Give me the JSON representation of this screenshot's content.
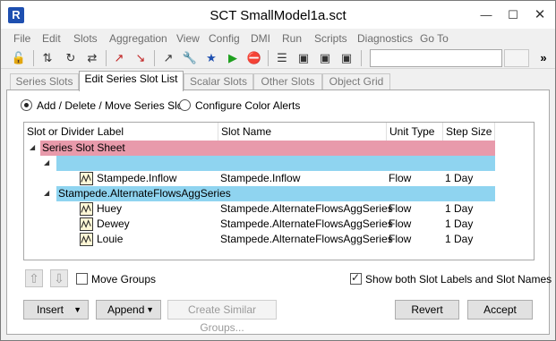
{
  "window": {
    "title": "SCT SmallModel1a.sct",
    "app_icon": "R"
  },
  "menu": [
    "File",
    "Edit",
    "Slots",
    "Aggregation",
    "View",
    "Config",
    "DMI",
    "Run",
    "Scripts",
    "Diagnostics",
    "Go To"
  ],
  "tabs": [
    {
      "label": "Series Slots",
      "active": false
    },
    {
      "label": "Edit Series Slot List",
      "active": true
    },
    {
      "label": "Scalar Slots",
      "active": false
    },
    {
      "label": "Other Slots",
      "active": false
    },
    {
      "label": "Object Grid",
      "active": false
    }
  ],
  "mode": {
    "option1": "Add / Delete / Move Series Slot",
    "option2": "Configure Color Alerts",
    "selected": "option1"
  },
  "grid": {
    "headers": [
      "Slot or Divider Label",
      "Slot Name",
      "Unit Type",
      "Step Size"
    ],
    "rows": [
      {
        "label": "Series Slot Sheet",
        "slot": "",
        "unit": "",
        "step": "",
        "type": "sheet"
      },
      {
        "label": "",
        "slot": "",
        "unit": "",
        "step": "",
        "type": "divider"
      },
      {
        "label": "Stampede.Inflow",
        "slot": "Stampede.Inflow",
        "unit": "Flow",
        "step": "1 Day",
        "type": "slot"
      },
      {
        "label": "Stampede.AlternateFlowsAggSeries",
        "slot": "",
        "unit": "",
        "step": "",
        "type": "divider"
      },
      {
        "label": "Huey",
        "slot": "Stampede.AlternateFlowsAggSeries",
        "unit": "Flow",
        "step": "1 Day",
        "type": "slot"
      },
      {
        "label": "Dewey",
        "slot": "Stampede.AlternateFlowsAggSeries",
        "unit": "Flow",
        "step": "1 Day",
        "type": "slot"
      },
      {
        "label": "Louie",
        "slot": "Stampede.AlternateFlowsAggSeries",
        "unit": "Flow",
        "step": "1 Day",
        "type": "slot"
      }
    ]
  },
  "options": {
    "move_groups": "Move Groups",
    "move_groups_checked": false,
    "show_both": "Show both Slot Labels and Slot Names",
    "show_both_checked": true
  },
  "buttons": {
    "insert": "Insert",
    "append": "Append",
    "create_similar": "Create Similar Groups...",
    "revert": "Revert",
    "accept": "Accept"
  },
  "colors": {
    "sheet_row": "#e89aab",
    "divider_row": "#8fd4f0",
    "accent": "#1e4fb0"
  }
}
